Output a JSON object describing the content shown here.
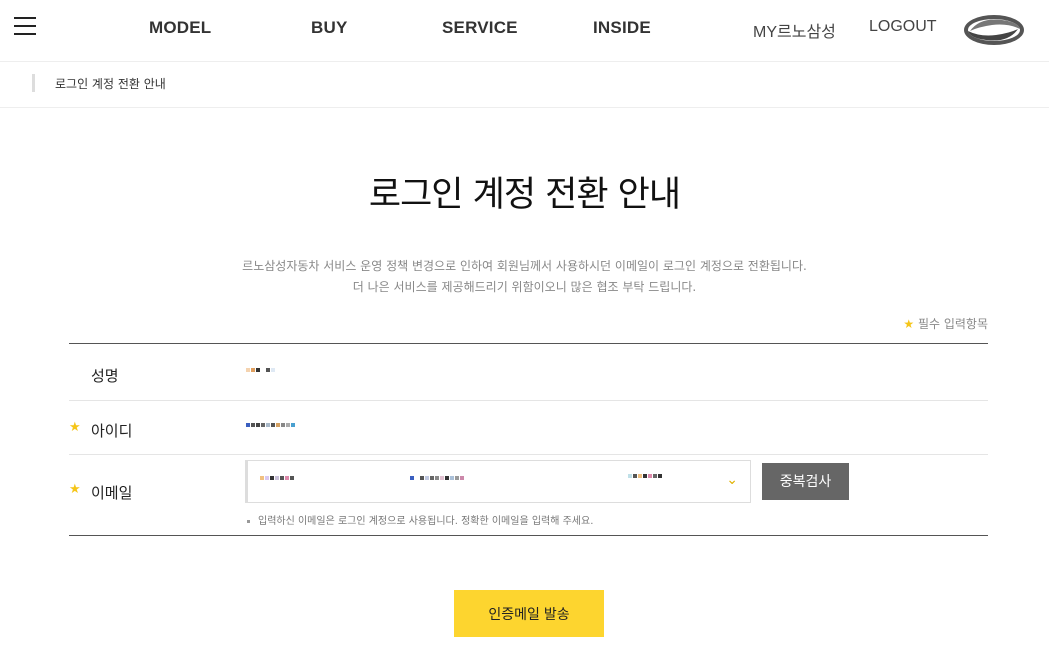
{
  "header": {
    "nav": [
      "MODEL",
      "BUY",
      "SERVICE",
      "INSIDE"
    ],
    "my_link": "MY르노삼성",
    "logout": "LOGOUT"
  },
  "breadcrumb": "로그인 계정 전환 안내",
  "title": "로그인 계정 전환 안내",
  "description": [
    "르노삼성자동차 서비스 운영 정책 변경으로 인하여 회원님께서 사용하시던 이메일이 로그인 계정으로 전환됩니다.",
    "더 나은 서비스를 제공해드리기 위함이오니 많은 협조 부탁 드립니다."
  ],
  "required_note": "필수 입력항목",
  "required_star": "★",
  "form": {
    "name_label": "성명",
    "id_label": "아이디",
    "email_label": "이메일",
    "duplicate_check": "중복검사",
    "email_hint": "입력하신 이메일은 로그인 계정으로 사용됩니다. 정확한 이메일을 입력해 주세요."
  },
  "submit": "인증메일 발송",
  "colors": {
    "accent_yellow": "#fdd52f",
    "star_yellow": "#f5c518",
    "button_gray": "#666666"
  },
  "icons": [
    "menu-icon",
    "brand-logo",
    "chevron-down-icon"
  ]
}
